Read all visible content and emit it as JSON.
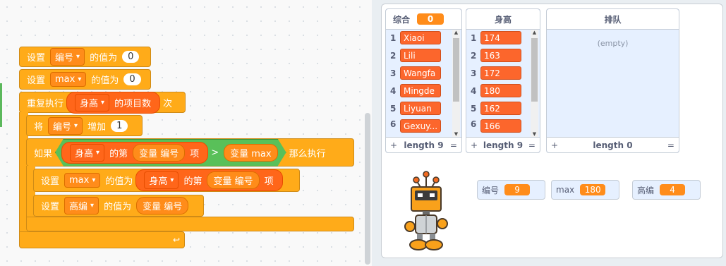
{
  "script": {
    "set_label": "设置",
    "value_to": "的值为",
    "var_id": "编号",
    "var_max": "max",
    "zero_1": "0",
    "zero_2": "0",
    "repeat": "重复执行",
    "list_height": "身高",
    "item_count": "的项目数",
    "times": "次",
    "change_prefix": "将",
    "change_by": "增加",
    "one": "1",
    "if_label": "如果",
    "item_of": "的第",
    "var_reporter_id": "变量 编号",
    "item_suffix": "项",
    "gt": ">",
    "var_reporter_max": "变量 max",
    "then_label": "那么执行",
    "var_gaobian": "高编",
    "loop_arrow": "↩"
  },
  "stage": {
    "list_zonghe": {
      "title": "综合",
      "title_value": "0",
      "items": [
        "Xiaoi",
        "Lili",
        "Wangfa",
        "Mingde",
        "Liyuan",
        "Gexuy..."
      ],
      "indices": [
        "1",
        "2",
        "3",
        "4",
        "5",
        "6"
      ],
      "add": "+",
      "length": "length 9",
      "eq": "="
    },
    "list_shengao": {
      "title": "身高",
      "items": [
        "174",
        "163",
        "172",
        "180",
        "162",
        "166"
      ],
      "indices": [
        "1",
        "2",
        "3",
        "4",
        "5",
        "6"
      ],
      "add": "+",
      "length": "length 9",
      "eq": "="
    },
    "list_paidui": {
      "title": "排队",
      "empty": "(empty)",
      "add": "+",
      "length": "length 0",
      "eq": "="
    },
    "monitors": [
      {
        "label": "编号",
        "value": "9"
      },
      {
        "label": "max",
        "value": "180"
      },
      {
        "label": "高编",
        "value": "4"
      }
    ]
  },
  "colors": {
    "control": "#ffab19",
    "variable": "#ff8c1a",
    "list": "#ff661a",
    "operator": "#59c059"
  }
}
